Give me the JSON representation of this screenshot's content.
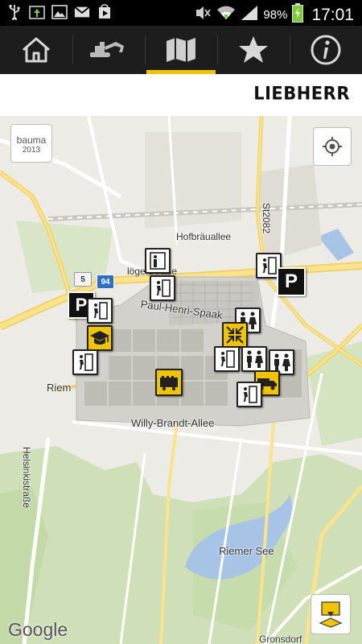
{
  "status_bar": {
    "battery_percent": "98%",
    "time": "17:01",
    "icons": [
      "usb-icon",
      "download-icon",
      "image-icon",
      "gmail-icon",
      "play-store-icon",
      "mute-icon",
      "wifi-icon",
      "signal-icon",
      "battery-icon"
    ]
  },
  "toolbar": {
    "items": [
      {
        "name": "home-icon",
        "active": false
      },
      {
        "name": "excavator-icon",
        "active": false
      },
      {
        "name": "map-icon",
        "active": true
      },
      {
        "name": "star-icon",
        "active": false
      },
      {
        "name": "info-icon",
        "active": false
      }
    ],
    "active_color": "#f3c200"
  },
  "brand": {
    "logo_text": "LIEBHERR"
  },
  "map": {
    "bauma_logo": {
      "line1": "bauma",
      "line2": "2013"
    },
    "labels": {
      "hofbraeuallee": "Hofbräuallee",
      "paul_henri": "Paul-Henri-Spaak",
      "strasse_top": "löge Straße",
      "willy_brandt": "Willy-Brandt-Allee",
      "riem": "Riem",
      "helsinki": "Helsinkistraße",
      "st2082": "St2082",
      "riemer_see": "Riemer See",
      "gronsdorf": "Gronsdorf",
      "shield_94": "94",
      "shield_5": "5"
    },
    "attribution": "Google",
    "parking_label": "P"
  }
}
